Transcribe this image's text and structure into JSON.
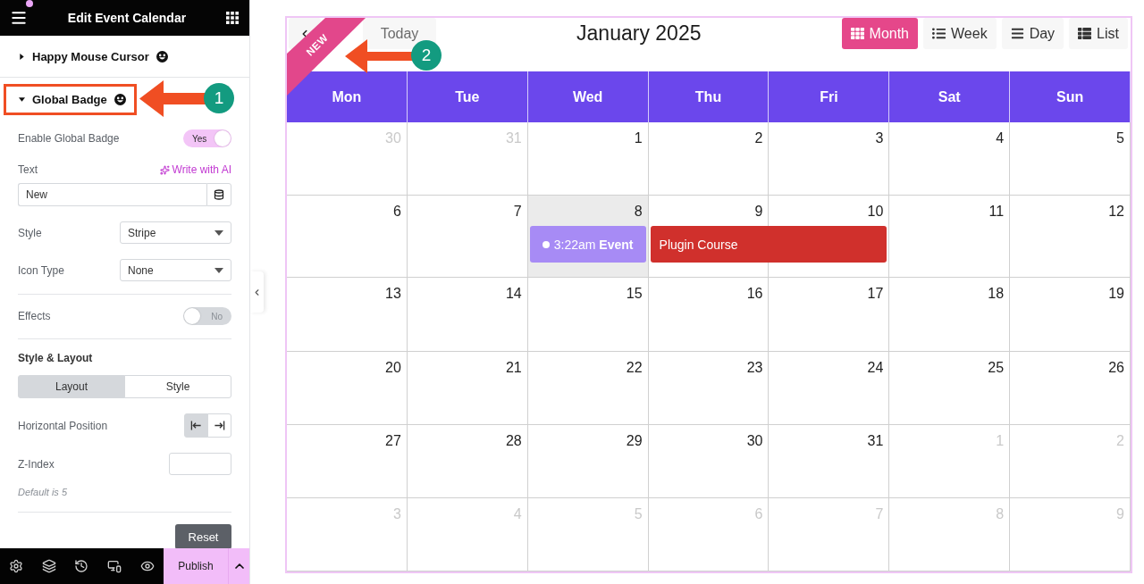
{
  "editor": {
    "title": "Edit Event Calendar"
  },
  "sections": [
    {
      "title": "Happy Mouse Cursor",
      "expanded": false
    },
    {
      "title": "Global Badge",
      "expanded": true,
      "groups": [
        {
          "controls": [
            {
              "kind": "switch",
              "label": "Enable Global Badge",
              "on": true,
              "state": "Yes"
            },
            {
              "kind": "text",
              "label": "Text",
              "link": "Write with AI",
              "value": "New"
            },
            {
              "kind": "select",
              "label": "Style",
              "value": "Stripe"
            },
            {
              "kind": "select",
              "label": "Icon Type",
              "value": "None"
            }
          ]
        },
        {
          "controls": [
            {
              "kind": "switch",
              "label": "Effects",
              "on": false,
              "state": "No"
            }
          ]
        },
        {
          "controls": [
            {
              "kind": "heading",
              "label": "Style & Layout"
            },
            {
              "kind": "tabs",
              "tabs": [
                {
                  "label": "Layout",
                  "selected": true
                },
                {
                  "label": "Style",
                  "selected": false
                }
              ]
            },
            {
              "kind": "choice",
              "label": "Horizontal Position",
              "options": [
                {
                  "kind": "start",
                  "selected": true
                },
                {
                  "kind": "end",
                  "selected": false
                }
              ]
            },
            {
              "kind": "number",
              "label": "Z-Index"
            },
            {
              "kind": "note",
              "text": "Default is 5"
            }
          ]
        }
      ],
      "button": "Reset"
    }
  ],
  "footer": {
    "publish": "Publish"
  },
  "calendar": {
    "badge": "NEW",
    "today": "Today",
    "title": "January 2025",
    "views": [
      {
        "kind": "month",
        "label": "Month",
        "selected": true
      },
      {
        "kind": "week",
        "label": "Week",
        "selected": false
      },
      {
        "kind": "day",
        "label": "Day",
        "selected": false
      },
      {
        "kind": "list",
        "label": "List",
        "selected": false
      }
    ],
    "weekdays": [
      "Mon",
      "Tue",
      "Wed",
      "Thu",
      "Fri",
      "Sat",
      "Sun"
    ],
    "weeks": [
      {
        "days": [
          {
            "date": "30",
            "other_month": true,
            "today": false
          },
          {
            "date": "31",
            "other_month": true,
            "today": false
          },
          {
            "date": "1",
            "other_month": false,
            "today": false
          },
          {
            "date": "2",
            "other_month": false,
            "today": false
          },
          {
            "date": "3",
            "other_month": false,
            "today": false
          },
          {
            "date": "4",
            "other_month": false,
            "today": false
          },
          {
            "date": "5",
            "other_month": false,
            "today": false
          }
        ]
      },
      {
        "days": [
          {
            "date": "6",
            "other_month": false,
            "today": false
          },
          {
            "date": "7",
            "other_month": false,
            "today": false
          },
          {
            "date": "8",
            "other_month": false,
            "today": true,
            "events": [
              {
                "kind": "timed",
                "time": "3:22am",
                "title": "Event",
                "color": "#a78bf5",
                "spans_next_day": false
              }
            ]
          },
          {
            "date": "9",
            "other_month": false,
            "today": false,
            "events": [
              {
                "kind": "allday",
                "title": "Plugin Course",
                "color": "#d0302c",
                "spans_next_day": true
              }
            ]
          },
          {
            "date": "10",
            "other_month": false,
            "today": false
          },
          {
            "date": "11",
            "other_month": false,
            "today": false
          },
          {
            "date": "12",
            "other_month": false,
            "today": false
          }
        ]
      },
      {
        "days": [
          {
            "date": "13",
            "other_month": false,
            "today": false
          },
          {
            "date": "14",
            "other_month": false,
            "today": false
          },
          {
            "date": "15",
            "other_month": false,
            "today": false
          },
          {
            "date": "16",
            "other_month": false,
            "today": false
          },
          {
            "date": "17",
            "other_month": false,
            "today": false
          },
          {
            "date": "18",
            "other_month": false,
            "today": false
          },
          {
            "date": "19",
            "other_month": false,
            "today": false
          }
        ]
      },
      {
        "days": [
          {
            "date": "20",
            "other_month": false,
            "today": false
          },
          {
            "date": "21",
            "other_month": false,
            "today": false
          },
          {
            "date": "22",
            "other_month": false,
            "today": false
          },
          {
            "date": "23",
            "other_month": false,
            "today": false
          },
          {
            "date": "24",
            "other_month": false,
            "today": false
          },
          {
            "date": "25",
            "other_month": false,
            "today": false
          },
          {
            "date": "26",
            "other_month": false,
            "today": false
          }
        ]
      },
      {
        "days": [
          {
            "date": "27",
            "other_month": false,
            "today": false
          },
          {
            "date": "28",
            "other_month": false,
            "today": false
          },
          {
            "date": "29",
            "other_month": false,
            "today": false
          },
          {
            "date": "30",
            "other_month": false,
            "today": false
          },
          {
            "date": "31",
            "other_month": false,
            "today": false
          },
          {
            "date": "1",
            "other_month": true,
            "today": false
          },
          {
            "date": "2",
            "other_month": true,
            "today": false
          }
        ]
      },
      {
        "days": [
          {
            "date": "3",
            "other_month": true,
            "today": false
          },
          {
            "date": "4",
            "other_month": true,
            "today": false
          },
          {
            "date": "5",
            "other_month": true,
            "today": false
          },
          {
            "date": "6",
            "other_month": true,
            "today": false
          },
          {
            "date": "7",
            "other_month": true,
            "today": false
          },
          {
            "date": "8",
            "other_month": true,
            "today": false
          },
          {
            "date": "9",
            "other_month": true,
            "today": false
          }
        ]
      }
    ]
  },
  "annotations": [
    {
      "label": "1"
    },
    {
      "label": "2"
    }
  ]
}
